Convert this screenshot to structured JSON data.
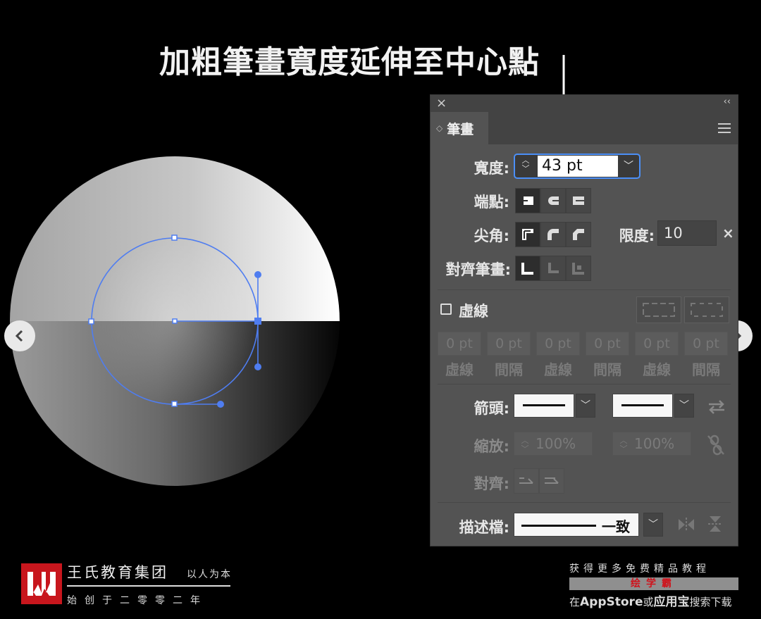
{
  "annotation": {
    "heading": "加粗筆畫寬度延伸至中心點"
  },
  "nav": {
    "prev_icon": "chevron-left-icon",
    "next_icon": "chevron-right-icon"
  },
  "panel": {
    "close_icon": "×",
    "collapse_icon": "‹‹",
    "tab_label": "筆畫",
    "width_label": "寬度:",
    "width_value": "43 pt",
    "cap_label": "端點:",
    "corner_label": "尖角:",
    "limit_label": "限度:",
    "limit_value": "10",
    "limit_x": "×",
    "align_label": "對齊筆畫:",
    "dashed_label": "虛線",
    "dash_fields": [
      "0 pt",
      "0 pt",
      "0 pt",
      "0 pt",
      "0 pt",
      "0 pt"
    ],
    "dash_labels": [
      "虛線",
      "間隔",
      "虛線",
      "間隔",
      "虛線",
      "間隔"
    ],
    "arrowheads_label": "箭頭:",
    "scale_label": "縮放:",
    "scale_values": [
      "100%",
      "100%"
    ],
    "arrow_align_label": "對齊:",
    "profile_label": "描述檔:",
    "profile_value": "一致"
  },
  "footer": {
    "brand_name": "王氏教育集团",
    "motto": "以人为本",
    "founded": "始创于二零零二年",
    "promo_line1": "获得更多免费精品教程",
    "promo_app": "绘学霸",
    "promo_line3_a": "在",
    "promo_line3_b": "AppStore",
    "promo_line3_c": "或",
    "promo_line3_d": "应用宝",
    "promo_line3_e": "搜索下载"
  },
  "colors": {
    "accent": "#4b8ff7",
    "panel_bg": "#535353",
    "logo_red": "#c8161d",
    "promo_red": "#d0121b"
  }
}
